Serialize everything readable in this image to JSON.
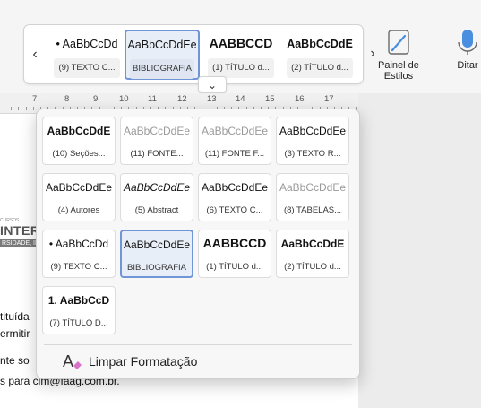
{
  "toolbar": {
    "prev_arrow": "‹",
    "next_arrow": "›",
    "expand_chevron": "⌄",
    "gallery": [
      {
        "preview": "• AaBbCcDd",
        "caption": "(9) TEXTO C...",
        "selected": false,
        "bold": false
      },
      {
        "preview": "AaBbCcDdEe",
        "caption": "BIBLIOGRAFIA",
        "selected": true,
        "bold": false
      },
      {
        "preview": "AABBCCD",
        "caption": "(1) TÍTULO d...",
        "selected": false,
        "bold": true
      },
      {
        "preview": "AaBbCcDdE",
        "caption": "(2) TÍTULO d...",
        "selected": false,
        "bold": true
      }
    ],
    "styles_pane_label_1": "Painel de",
    "styles_pane_label_2": "Estilos",
    "dictate_label": "Ditar"
  },
  "ruler": {
    "numbers": [
      "7",
      "8",
      "9",
      "10",
      "11",
      "12",
      "13",
      "14",
      "15",
      "16",
      "17"
    ]
  },
  "document": {
    "logo_small": "CURSOS",
    "logo_big": "INTERNA",
    "logo_sub": "RSIDADE, INT",
    "line1": "tituída",
    "line2": "ermitir",
    "line3": "nte so",
    "line4": "s para cim@faag.com.br."
  },
  "styles_dropdown": {
    "tiles": [
      {
        "preview": "AaBbCcDdE",
        "caption": "(10) Seções...",
        "style": "bold"
      },
      {
        "preview": "AaBbCcDdEe",
        "caption": "(11) FONTE...",
        "style": "muted"
      },
      {
        "preview": "AaBbCcDdEe",
        "caption": "(11) FONTE F...",
        "style": "muted"
      },
      {
        "preview": "AaBbCcDdEe",
        "caption": "(3) TEXTO R...",
        "style": "normal"
      },
      {
        "preview": "AaBbCcDdEe",
        "caption": "(4) Autores",
        "style": "normal"
      },
      {
        "preview": "AaBbCcDdEe",
        "caption": "(5) Abstract",
        "style": "italic"
      },
      {
        "preview": "AaBbCcDdEe",
        "caption": "(6) TEXTO C...",
        "style": "normal"
      },
      {
        "preview": "AaBbCcDdEe",
        "caption": "(8) TABELAS...",
        "style": "muted"
      },
      {
        "preview": "• AaBbCcDd",
        "caption": "(9) TEXTO C...",
        "style": "normal"
      },
      {
        "preview": "AaBbCcDdEe",
        "caption": "BIBLIOGRAFIA",
        "style": "selected"
      },
      {
        "preview": "AABBCCD",
        "caption": "(1) TÍTULO d...",
        "style": "big"
      },
      {
        "preview": "AaBbCcDdE",
        "caption": "(2) TÍTULO d...",
        "style": "bold"
      },
      {
        "preview": "1. AaBbCcD",
        "caption": "(7) TÍTULO D...",
        "style": "bold"
      }
    ],
    "clear_formatting_label": "Limpar Formatação"
  }
}
